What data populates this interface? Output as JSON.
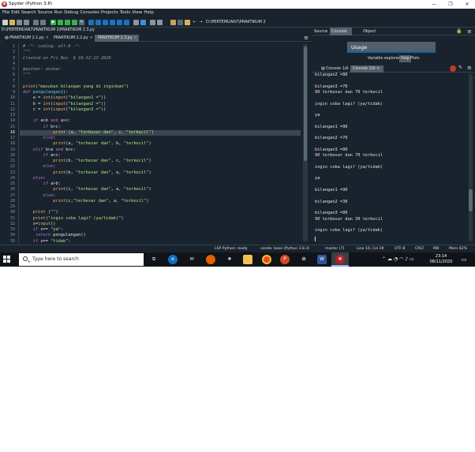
{
  "window": {
    "title": "Spyder (Python 3.8)",
    "controls": [
      "—",
      "❐",
      "✕"
    ]
  },
  "menu": [
    "File",
    "Edit",
    "Search",
    "Source",
    "Run",
    "Debug",
    "Consoles",
    "Projects",
    "Tools",
    "View",
    "Help"
  ],
  "toolbar": {
    "path": "D:\\PERTEMUAN7\\PRAKTIKUM 2"
  },
  "breadcrumb": "D:\\PERTEMUAN7\\PRAKTIKUM 2\\PRAKTIKUM 2.3.py",
  "editor_tabs": [
    {
      "label": "PRAKTIKUM 2.1.py",
      "active": false
    },
    {
      "label": "PRAKTIKUM 2.2.py",
      "active": false
    },
    {
      "label": "PRAKTIKUM 2.3.py",
      "active": true
    }
  ],
  "editor": {
    "current_line": 16,
    "line_numbers": [
      "1",
      "2",
      "3",
      "4",
      "5",
      "6",
      "7",
      "8",
      "9",
      "10",
      "11",
      "12",
      "13",
      "14",
      "15",
      "16",
      "17",
      "18",
      "19",
      "20",
      "21",
      "22",
      "23",
      "24",
      "25",
      "26",
      "27",
      "28",
      "29",
      "30",
      "31",
      "32",
      "33",
      "34",
      "35"
    ],
    "lines": [
      [
        [
          "cm",
          "# -*- coding: utf-8 -*-"
        ]
      ],
      [
        [
          "cm",
          "\"\"\""
        ]
      ],
      [
        [
          "cm",
          "Created on Fri Nov  6 16:12:13 2020"
        ]
      ],
      [],
      [
        [
          "cm",
          "@author: anshar"
        ]
      ],
      [
        [
          "cm",
          "\"\"\""
        ]
      ],
      [],
      [
        [
          "bi",
          "print"
        ],
        [
          "",
          "("
        ],
        [
          "st",
          "\"masukan bilangan yang di inginkan\""
        ],
        [
          "",
          ")"
        ]
      ],
      [
        [
          "kw",
          "def "
        ],
        [
          "fn",
          "pengulangan"
        ],
        [
          "",
          "():"
        ]
      ],
      [
        [
          "",
          "    a = "
        ],
        [
          "bi",
          "int"
        ],
        [
          "",
          "("
        ],
        [
          "bi",
          "input"
        ],
        [
          "",
          "("
        ],
        [
          "st",
          "\"bilangan1 =\""
        ],
        [
          "",
          "))"
        ]
      ],
      [
        [
          "",
          "    b = "
        ],
        [
          "bi",
          "int"
        ],
        [
          "",
          "("
        ],
        [
          "bi",
          "input"
        ],
        [
          "",
          "("
        ],
        [
          "st",
          "\"bilangan2 =\""
        ],
        [
          "",
          "))"
        ]
      ],
      [
        [
          "",
          "    c = "
        ],
        [
          "bi",
          "int"
        ],
        [
          "",
          "("
        ],
        [
          "bi",
          "input"
        ],
        [
          "",
          "("
        ],
        [
          "st",
          "\"bilangan3 =\""
        ],
        [
          "",
          "))"
        ]
      ],
      [],
      [
        [
          "",
          "    "
        ],
        [
          "kw",
          "if"
        ],
        [
          "",
          " a>b "
        ],
        [
          "kw",
          "and"
        ],
        [
          "",
          " a>c:"
        ]
      ],
      [
        [
          "",
          "        "
        ],
        [
          "kw",
          "if"
        ],
        [
          "",
          " b>c:"
        ]
      ],
      [
        [
          "",
          "            "
        ],
        [
          "bi",
          "print"
        ],
        [
          "",
          " (a, "
        ],
        [
          "st",
          "\"terbesar dan\""
        ],
        [
          "",
          ", c, "
        ],
        [
          "st",
          "\"terkecil\""
        ],
        [
          "",
          ")"
        ]
      ],
      [
        [
          "",
          "        "
        ],
        [
          "kw",
          "else"
        ],
        [
          "",
          ":"
        ]
      ],
      [
        [
          "",
          "            "
        ],
        [
          "bi",
          "print"
        ],
        [
          "",
          "(a, "
        ],
        [
          "st",
          "\"terbesar dan\""
        ],
        [
          "",
          ", b, "
        ],
        [
          "st",
          "\"terkecil\""
        ],
        [
          "",
          ")"
        ]
      ],
      [
        [
          "",
          "    "
        ],
        [
          "kw",
          "elif"
        ],
        [
          "",
          " b>a "
        ],
        [
          "kw",
          "and"
        ],
        [
          "",
          " b>c:"
        ]
      ],
      [
        [
          "",
          "        "
        ],
        [
          "kw",
          "if"
        ],
        [
          "",
          " a>c:"
        ]
      ],
      [
        [
          "",
          "            "
        ],
        [
          "bi",
          "print"
        ],
        [
          "",
          "(b, "
        ],
        [
          "st",
          "\"terbesar dan\""
        ],
        [
          "",
          ", c, "
        ],
        [
          "st",
          "\"terkecil\""
        ],
        [
          "",
          ")"
        ]
      ],
      [
        [
          "",
          "        "
        ],
        [
          "kw",
          "else"
        ],
        [
          "",
          ":"
        ]
      ],
      [
        [
          "",
          "            "
        ],
        [
          "bi",
          "print"
        ],
        [
          "",
          "(b, "
        ],
        [
          "st",
          "\"terbesar dan\""
        ],
        [
          "",
          ", a, "
        ],
        [
          "st",
          "\"terkecil\""
        ],
        [
          "",
          ")"
        ]
      ],
      [
        [
          "",
          "    "
        ],
        [
          "kw",
          "else"
        ],
        [
          "",
          ":"
        ]
      ],
      [
        [
          "",
          "        "
        ],
        [
          "kw",
          "if"
        ],
        [
          "",
          " a>b:"
        ]
      ],
      [
        [
          "",
          "            "
        ],
        [
          "bi",
          "print"
        ],
        [
          "",
          "(c, "
        ],
        [
          "st",
          "\"terbesar dan\""
        ],
        [
          "",
          ", a, "
        ],
        [
          "st",
          "\"terkecil\""
        ],
        [
          "",
          ")"
        ]
      ],
      [
        [
          "",
          "        "
        ],
        [
          "kw",
          "else"
        ],
        [
          "",
          ":"
        ]
      ],
      [
        [
          "",
          "            "
        ],
        [
          "bi",
          "print"
        ],
        [
          "",
          "(c,"
        ],
        [
          "st",
          "\"terbesar dan\""
        ],
        [
          "",
          ", a, "
        ],
        [
          "st",
          "\"terkecil\""
        ],
        [
          "",
          ")"
        ]
      ],
      [],
      [
        [
          "",
          "    "
        ],
        [
          "bi",
          "print"
        ],
        [
          "",
          " ("
        ],
        [
          "st",
          "\"\""
        ],
        [
          "",
          ")"
        ]
      ],
      [
        [
          "",
          "    "
        ],
        [
          "bi",
          "print"
        ],
        [
          "",
          "("
        ],
        [
          "st",
          "\"ingin coba lagi? (ya/tidak)\""
        ],
        [
          "",
          ")"
        ]
      ],
      [
        [
          "",
          "    x="
        ],
        [
          "bi",
          "input"
        ],
        [
          "",
          "()"
        ]
      ],
      [
        [
          "",
          "    "
        ],
        [
          "kw",
          "if"
        ],
        [
          "",
          " x== "
        ],
        [
          "st",
          "\"ya\""
        ],
        [
          "",
          ":"
        ]
      ],
      [
        [
          "",
          "     "
        ],
        [
          "kw",
          "return"
        ],
        [
          "",
          " pengulangan()"
        ]
      ],
      [
        [
          "",
          "    "
        ],
        [
          "kw",
          "if"
        ],
        [
          "",
          " x== "
        ],
        [
          "st",
          "\"tidak\""
        ],
        [
          "",
          ":"
        ]
      ]
    ]
  },
  "help_pane": {
    "source_label": "Source",
    "source_value": "Console",
    "object_label": "Object",
    "usage": "Usage",
    "panel_tabs": [
      "Variable explorer",
      "Help",
      "Plots"
    ],
    "active_panel": "Help"
  },
  "console_tabs": [
    {
      "label": "Console 1/A",
      "active": false
    },
    {
      "label": "Console 2/A",
      "active": true
    }
  ],
  "console": {
    "lines": [
      "bilangan2 =80",
      "",
      "bilangan3 =70",
      "90 terbesar dan 70 terkecil",
      "",
      "ingin coba lagi? (ya/tidak)",
      "",
      "ya",
      "",
      "bilangan1 =90",
      "",
      "bilangan2 =70",
      "",
      "bilangan3 =80",
      "90 terbesar dan 70 terkecil",
      "",
      "ingin coba lagi? (ya/tidak)",
      "",
      "ya",
      "",
      "bilangan1 =90",
      "",
      "bilangan2 =30",
      "",
      "bilangan3 =80",
      "90 terbesar dan 30 terkecil",
      "",
      "ingin coba lagi? (ya/tidak)"
    ]
  },
  "status": {
    "lsp": "LSP Python: ready",
    "conda": "conda: base (Python 3.8.3)",
    "git": "master [7]",
    "position": "Line 16, Col 39",
    "encoding": "UTF-8",
    "eol": "CRLF",
    "rw": "RW",
    "mem": "Mem 62%"
  },
  "taskbar": {
    "search_placeholder": "Type here to search",
    "time": "23:14",
    "date": "08/11/2020"
  },
  "colors": {
    "background": "#19232d",
    "accent": "#1464a0",
    "keyword": "#c670e0",
    "string": "#b0e686",
    "comment": "#999999",
    "builtin": "#fab16c"
  }
}
